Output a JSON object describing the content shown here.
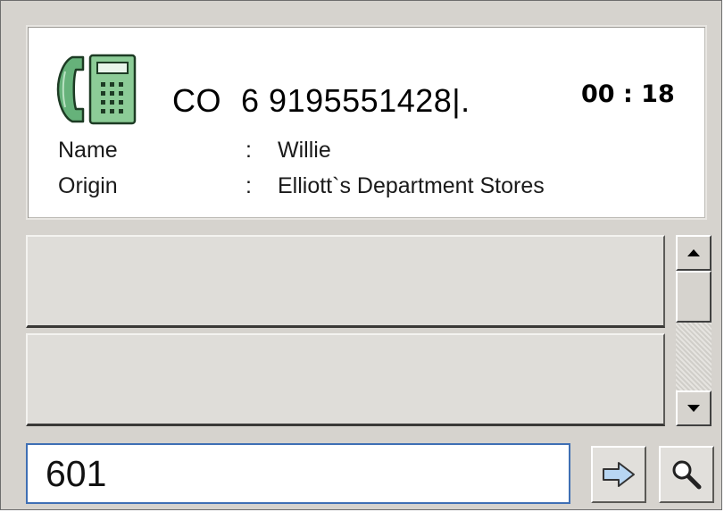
{
  "caller": {
    "line_prefix": "CO",
    "line_number": "6",
    "phone_number": "9195551428|.",
    "timer": "00 : 18",
    "name_label": "Name",
    "name_sep": ":",
    "name_value": "Willie",
    "origin_label": "Origin",
    "origin_sep": ":",
    "origin_value": "Elliott`s Department Stores"
  },
  "dial": {
    "value": "601"
  },
  "icons": {
    "phone": "telephone-handset-icon",
    "go": "arrow-right-icon",
    "search": "magnifier-icon",
    "scroll_up": "scroll-up-arrow-icon",
    "scroll_down": "scroll-down-arrow-icon"
  },
  "colors": {
    "phone_green": "#66b27a",
    "input_border": "#3f6fb4",
    "arrow_blue": "#b8d6f2"
  }
}
